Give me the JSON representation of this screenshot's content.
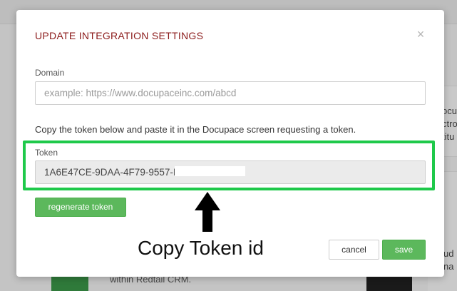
{
  "background": {
    "side_text": [
      "ocup",
      "ctro",
      "titu",
      "ud",
      "na"
    ],
    "bottom_text": "within Redtail CRM."
  },
  "modal": {
    "title": "UPDATE INTEGRATION SETTINGS",
    "close_glyph": "×",
    "domain": {
      "label": "Domain",
      "value": "",
      "placeholder": "example: https://www.docupaceinc.com/abcd"
    },
    "instruction": "Copy the token below and paste it in the Docupace screen requesting a token.",
    "token": {
      "label": "Token",
      "value": "1A6E47CE-9DAA-4F79-9557-I"
    },
    "regenerate_label": "regenerate token",
    "cancel_label": "cancel",
    "save_label": "save"
  },
  "annotation": {
    "text": "Copy Token id",
    "highlight_color": "#1ec94a",
    "arrow_icon": "up-arrow-icon"
  },
  "colors": {
    "title": "#8b1a1a",
    "primary_button": "#5cb85c"
  }
}
